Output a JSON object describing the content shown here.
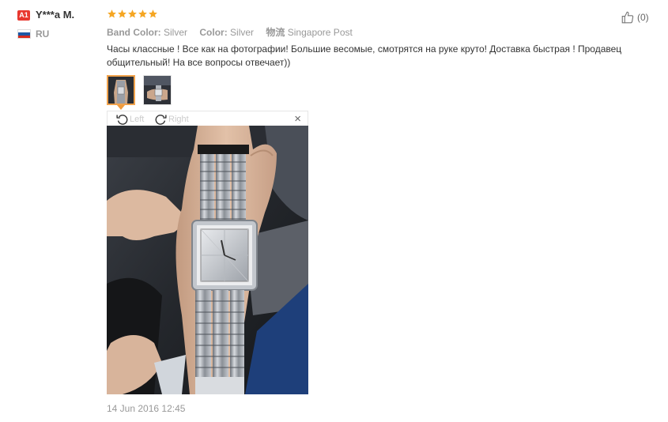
{
  "reviewer": {
    "badge": "A1",
    "name": "Y***a M.",
    "country_code": "RU",
    "flag_colors": [
      "#ffffff",
      "#1c57a5",
      "#d52b1e"
    ]
  },
  "rating": {
    "stars": 5,
    "max": 5,
    "color": "#f5a623"
  },
  "attributes": [
    {
      "label": "Band Color:",
      "value": "Silver"
    },
    {
      "label": "Color:",
      "value": "Silver"
    },
    {
      "label": "物流",
      "value": "Singapore Post"
    }
  ],
  "feedback_text": "Часы классные ! Все как на фотографии! Большие весомые, смотрятся на руке круто! Доставка быстрая ! Продавец общительный! На все вопросы отвечает))",
  "helpful": {
    "icon": "thumbs-up-icon",
    "count": "(0)"
  },
  "viewer": {
    "rotate_left": "Left",
    "rotate_right": "Right",
    "close": "×",
    "thumb_accent": "#f0a24c"
  },
  "date": "14 Jun 2016 12:45"
}
